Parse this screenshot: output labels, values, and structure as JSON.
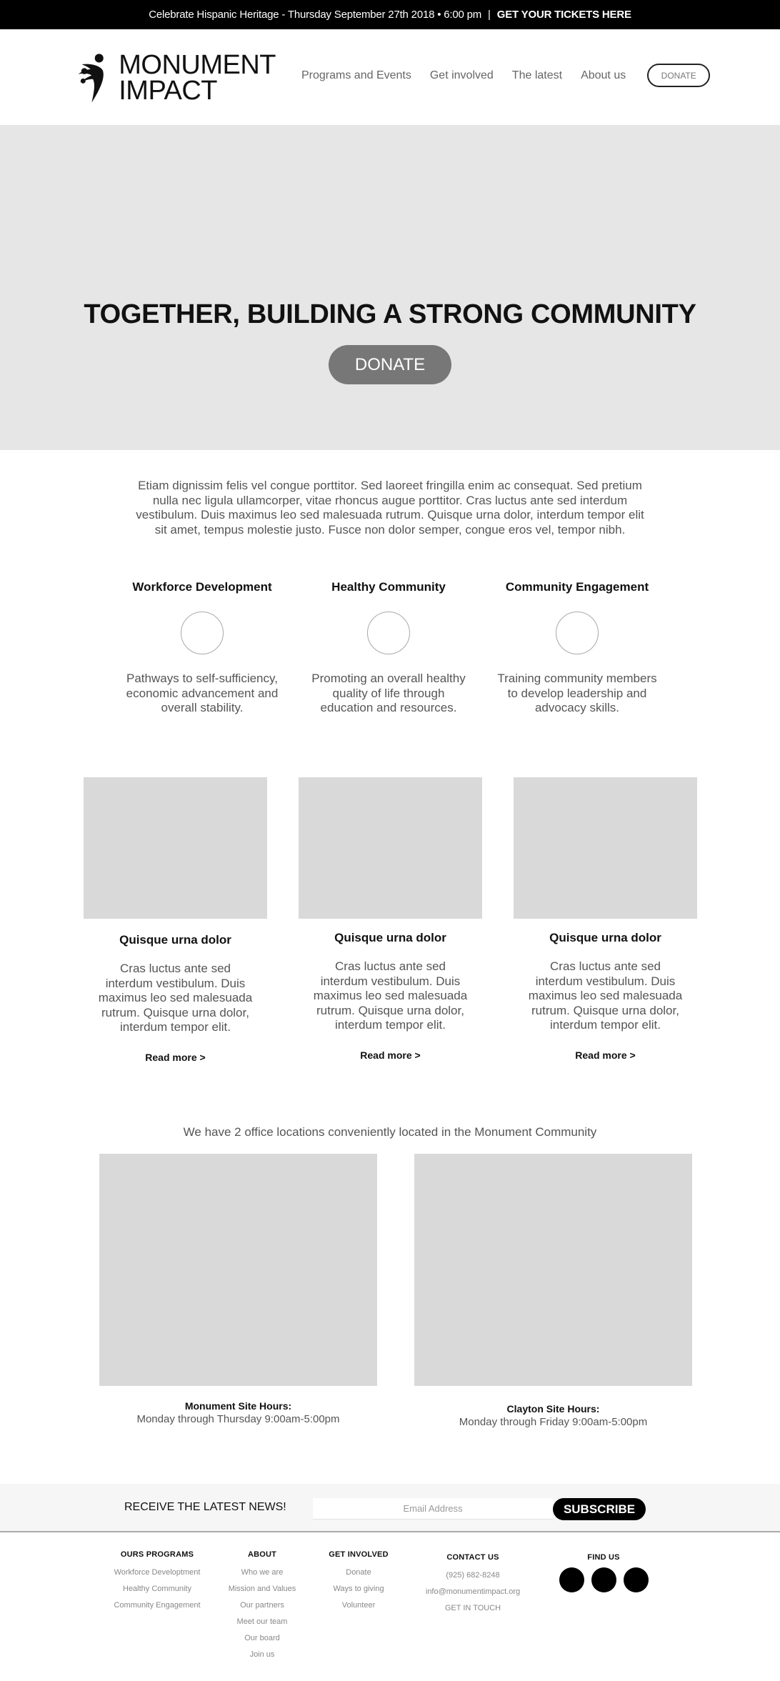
{
  "announcement": {
    "text": "Celebrate Hispanic Heritage - Thursday September 27th 2018 • 6:00 pm",
    "separator": "|",
    "cta": "GET YOUR TICKETS HERE"
  },
  "header": {
    "logo_line1": "MONUMENT",
    "logo_line2": "IMPACT",
    "nav": [
      {
        "label": "Programs and Events"
      },
      {
        "label": "Get involved"
      },
      {
        "label": "The latest"
      },
      {
        "label": "About us"
      }
    ],
    "donate_label": "DONATE"
  },
  "hero": {
    "title": "TOGETHER, BUILDING A STRONG COMMUNITY",
    "donate_label": "DONATE"
  },
  "intro": {
    "text": "Etiam dignissim felis vel congue porttitor. Sed laoreet fringilla enim ac consequat. Sed pretium nulla nec ligula ullamcorper, vitae rhoncus augue porttitor. Cras luctus ante sed interdum vestibulum. Duis maximus leo sed malesuada rutrum. Quisque urna dolor, interdum tempor elit sit amet, tempus molestie justo. Fusce non dolor semper, congue eros vel, tempor nibh."
  },
  "pillars": [
    {
      "title": "Workforce Development",
      "text": "Pathways to self-sufficiency, economic advancement and overall stability."
    },
    {
      "title": "Healthy Community",
      "text": "Promoting an overall healthy quality of life through education and resources."
    },
    {
      "title": "Community Engagement",
      "text": "Training community members to develop leadership and advocacy skills."
    }
  ],
  "cards": [
    {
      "title": "Quisque urna dolor",
      "text": "Cras luctus ante sed interdum vestibulum. Duis maximus leo sed malesuada rutrum. Quisque urna dolor, interdum tempor elit.",
      "link": "Read more >"
    },
    {
      "title": "Quisque urna dolor",
      "text": "Cras luctus ante sed interdum vestibulum. Duis maximus leo sed malesuada rutrum. Quisque urna dolor, interdum tempor elit.",
      "link": "Read more >"
    },
    {
      "title": "Quisque urna dolor",
      "text": "Cras luctus ante sed interdum vestibulum. Duis maximus leo sed malesuada rutrum. Quisque urna dolor, interdum tempor elit.",
      "link": "Read more >"
    }
  ],
  "locations": {
    "heading": "We have 2 office locations conveniently located in the Monument Community",
    "items": [
      {
        "name": "Monument Site Hours:",
        "hours": "Monday through Thursday 9:00am-5:00pm"
      },
      {
        "name": "Clayton Site Hours:",
        "hours": "Monday through Friday 9:00am-5:00pm"
      }
    ]
  },
  "subscribe": {
    "label": "RECEIVE THE LATEST NEWS!",
    "email_placeholder": "Email Address",
    "email_value": "",
    "button": "SUBSCRIBE"
  },
  "footer": {
    "programs": {
      "title": "OURS PROGRAMS",
      "links": [
        "Workforce Developtment",
        "Healthy Community",
        "Community Engagement"
      ]
    },
    "about": {
      "title": "ABOUT",
      "links": [
        "Who we are",
        "Mission and Values",
        "Our partners",
        "Meet our team",
        "Our board",
        "Join us"
      ]
    },
    "involved": {
      "title": "GET INVOLVED",
      "links": [
        "Donate",
        "Ways to giving",
        "Volunteer"
      ]
    },
    "contact": {
      "title": "CONTACT US",
      "phone": "(925) 682-8248",
      "email": "info@monumentimpact.org",
      "cta": "GET IN TOUCH"
    },
    "find": {
      "title": "FIND US",
      "social": [
        "social-icon-1",
        "social-icon-2",
        "social-icon-3"
      ]
    }
  }
}
